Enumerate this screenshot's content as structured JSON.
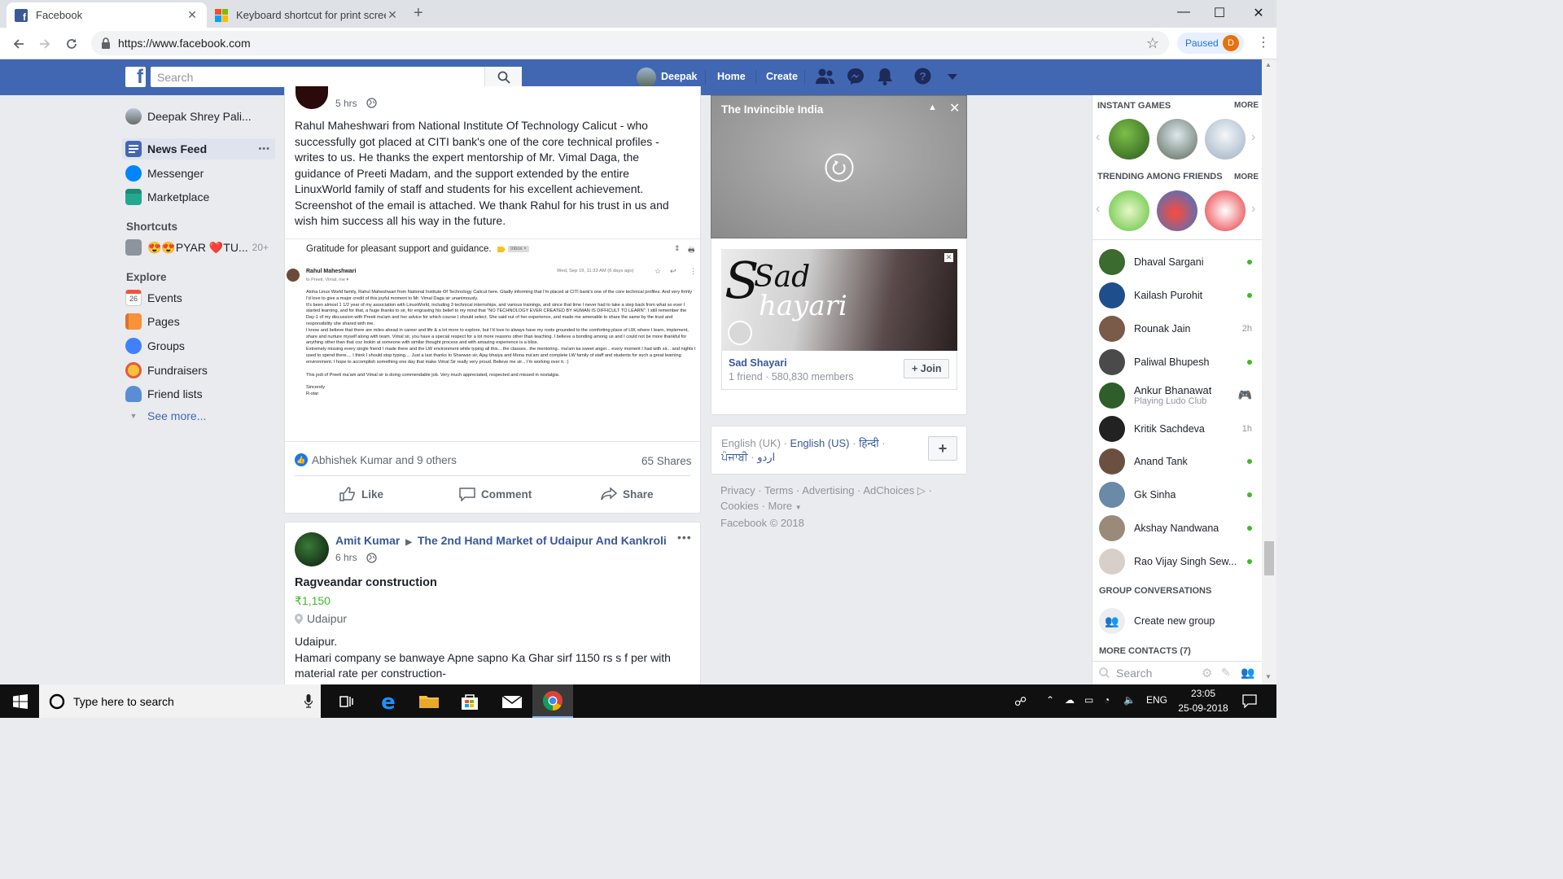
{
  "browser": {
    "tabs": [
      {
        "title": "Facebook",
        "active": true
      },
      {
        "title": "Keyboard shortcut for print scree",
        "active": false
      }
    ],
    "new_tab": "+",
    "url": "https://www.facebook.com",
    "profile_label": "Paused",
    "profile_initial": "D"
  },
  "fb_header": {
    "logo": "f",
    "search_placeholder": "Search",
    "user_name": "Deepak",
    "home": "Home",
    "create": "Create"
  },
  "left_nav": {
    "profile_name": "Deepak Shrey Pali...",
    "main": [
      {
        "label": "News Feed",
        "icon": "news-feed-icon",
        "color": "#4267b2"
      },
      {
        "label": "Messenger",
        "icon": "messenger-icon",
        "color": "#0084ff"
      },
      {
        "label": "Marketplace",
        "icon": "marketplace-icon",
        "color": "#23a88f"
      }
    ],
    "more_dots": "•••",
    "shortcuts_title": "Shortcuts",
    "shortcut": {
      "label": "😍😍PYAR ❤️TU...",
      "count": "20+"
    },
    "explore_title": "Explore",
    "explore": [
      {
        "label": "Events",
        "icon": "events-icon"
      },
      {
        "label": "Pages",
        "icon": "pages-icon"
      },
      {
        "label": "Groups",
        "icon": "groups-icon"
      },
      {
        "label": "Fundraisers",
        "icon": "fundraisers-icon"
      },
      {
        "label": "Friend lists",
        "icon": "friend-lists-icon"
      }
    ],
    "events_day": "26",
    "see_more": "See more..."
  },
  "post1": {
    "time": "5 hrs",
    "text": "Rahul Maheshwari from National Institute Of Technology Calicut - who successfully got placed at CITI bank's one of the core technical profiles - writes to us. He thanks the expert mentorship of Mr. Vimal Daga, the guidance of Preeti Madam, and the support extended by the entire LinuxWorld family of staff and students for his excellent achievement. Screenshot of the email is attached. We thank Rahul for his trust in us and wish him success all his way in the future.",
    "email": {
      "subject": "Gratitude for pleasant support and guidance.",
      "inbox_tag": "Inbox ×",
      "sender": "Rahul Maheshwari",
      "to": "to Preeti, Vimal, me ▾",
      "date": "Wed, Sep 19, 11:33 AM (6 days ago)",
      "body": [
        "Aloha Linux World family, Rahul Maheshwari from National Institute Of Technology Calicut here. Gladly informing that I'm placed at CITI bank's one of the core technical profiles. And very firmly I'd love to give a major credit of this joyful moment to Mr. Vimal Daga sir unanimously.",
        "It's been almost 1 1/2 year of my association with LinuxWorld, including 3 technical internships, and various trainings, and since that time I never had to take a step back from what so ever I started learning, and for that, a huge thanks to sir, for engraving his belief to my mind that \"NO TECHNOLOGY EVER CREATED BY HUMAN IS DIFFICULT TO LEARN\". I still remember the Day-1 of my discussion with Preeti ma'am and her advice for which course I should select. She said out of her experience, and made me amenable to share the same by the trust and responsibility she shared with me.",
        "I know and believe that there are miles ahead in career and life & a lot more to explore, but I'd love to always have my roots grounded to the comforting place of LW, where I learn, implement, share and nurture myself along with team. Vimal sir, you have a special respect for a lot more reasons other than teaching. I believe a bonding among us and I could not be more thankful for anything other than that coz lookin at someone with similar thought process and with amazing experience is a bliss.",
        "Extremely missing every single friend I made there and the LW environment while typing all this... the classes.. the mentoring.. ma'am ka sweet anger... every moment I had with sir... and nights I used to spend there.... I think I should stop typing.... Just a last thanks to Sharwan sir, Ajay bhaiya and Mona ma'am and complete LW family of staff and students for such a great learning environment. I hope to accomplish something one day that make Vimal Sir really very proud. Believe me sir... I'm working over it. :)",
        "This jodi of Preeti ma'am and Vimal sir is doing commendable job. Very much appreciated, respected and missed in nostalgia.",
        "Sincerely",
        "R-star"
      ]
    },
    "reactions": "Abhishek Kumar and 9 others",
    "shares": "65 Shares",
    "like": "Like",
    "comment": "Comment",
    "share": "Share"
  },
  "post2": {
    "author": "Amit Kumar",
    "group": "The 2nd Hand Market of Udaipur And Kankroli",
    "time": "6 hrs",
    "title": "Ragveandar construction",
    "price": "₹1,150",
    "location": "Udaipur",
    "text_line1": "Udaipur.",
    "text_line2": "Hamari company se banwaye Apne sapno Ka Ghar sirf 1150 rs s f per with material rate per construction-"
  },
  "video_popup": {
    "title": "The Invincible India"
  },
  "ad": {
    "image_text_1": "Sad",
    "image_text_2": "hayari",
    "image_text_s": "S",
    "name": "Sad Shayari",
    "meta": "1 friend · 580,830 members",
    "join": "+ Join"
  },
  "languages": {
    "current": "English (UK)",
    "others": [
      "English (US)",
      "हिन्दी",
      "ਪੰਜਾਬੀ",
      "اردو"
    ]
  },
  "footer_links": {
    "line1": [
      "Privacy",
      "Terms",
      "Advertising",
      "AdChoices"
    ],
    "line2": [
      "Cookies",
      "More"
    ],
    "copyright": "Facebook © 2018"
  },
  "right_col": {
    "instant_games": "INSTANT GAMES",
    "trending": "TRENDING AMONG FRIENDS",
    "more": "MORE",
    "contacts": [
      {
        "name": "Dhaval Sargani",
        "status": "online",
        "color": "#3b6b2e"
      },
      {
        "name": "Kailash Purohit",
        "status": "online",
        "color": "#1f4e8c"
      },
      {
        "name": "Rounak Jain",
        "status": "2h",
        "color": "#7a5a48"
      },
      {
        "name": "Paliwal Bhupesh",
        "status": "online",
        "color": "#4a4a4a"
      },
      {
        "name": "Ankur Bhanawat",
        "status": "game",
        "color": "#2f5e2a",
        "sub": "Playing Ludo Club"
      },
      {
        "name": "Kritik Sachdeva",
        "status": "1h",
        "color": "#222222"
      },
      {
        "name": "Anand Tank",
        "status": "online",
        "color": "#6b5040"
      },
      {
        "name": "Gk Sinha",
        "status": "online",
        "color": "#6a8aa8"
      },
      {
        "name": "Akshay Nandwana",
        "status": "online",
        "color": "#9a8a7a"
      },
      {
        "name": "Rao Vijay Singh Sew...",
        "status": "online",
        "color": "#d8d0c8"
      }
    ],
    "group_conversations": "GROUP CONVERSATIONS",
    "create_group": "Create new group",
    "more_contacts": "MORE CONTACTS (7)",
    "search_placeholder": "Search"
  },
  "taskbar": {
    "search_placeholder": "Type here to search",
    "lang": "ENG",
    "time": "23:05",
    "date": "25-09-2018"
  }
}
